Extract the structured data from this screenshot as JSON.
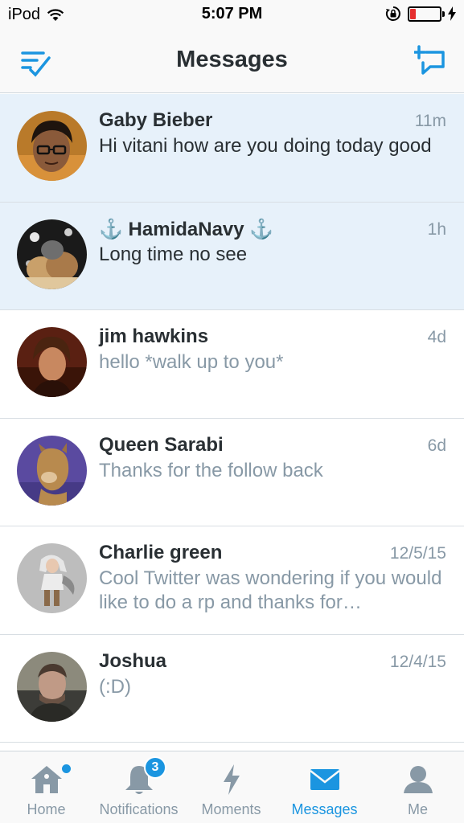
{
  "status_bar": {
    "carrier": "iPod",
    "time": "5:07 PM",
    "battery_color": "#e62e2e",
    "battery_level": 0.2
  },
  "nav": {
    "title": "Messages",
    "left_icon": "mark-all-read-icon",
    "right_icon": "compose-message-icon"
  },
  "conversations": [
    {
      "name": "Gaby Bieber",
      "time": "11m",
      "preview": "Hi vitani  how  are  you  doing  today  good",
      "unread": true
    },
    {
      "name": "⚓ HamidaNavy ⚓",
      "time": "1h",
      "preview": "Long time no see",
      "unread": true
    },
    {
      "name": "jim hawkins",
      "time": "4d",
      "preview": "hello *walk up to you*",
      "unread": false
    },
    {
      "name": "Queen Sarabi",
      "time": "6d",
      "preview": "Thanks for the follow back",
      "unread": false
    },
    {
      "name": "Charlie green",
      "time": "12/5/15",
      "preview": "Cool Twitter  was wondering  if you would like to do a rp  and thanks for…",
      "unread": false
    },
    {
      "name": "Joshua",
      "time": "12/4/15",
      "preview": "(:D)",
      "unread": false
    }
  ],
  "tabs": [
    {
      "label": "Home",
      "icon": "home-icon"
    },
    {
      "label": "Notifications",
      "icon": "bell-icon",
      "badge": "3"
    },
    {
      "label": "Moments",
      "icon": "lightning-icon"
    },
    {
      "label": "Messages",
      "icon": "envelope-icon",
      "active": true
    },
    {
      "label": "Me",
      "icon": "person-icon"
    }
  ],
  "colors": {
    "accent": "#1b95e0",
    "unread_bg": "#e7f1fa",
    "text_dark": "#292f33",
    "text_gray": "#8899a6"
  }
}
